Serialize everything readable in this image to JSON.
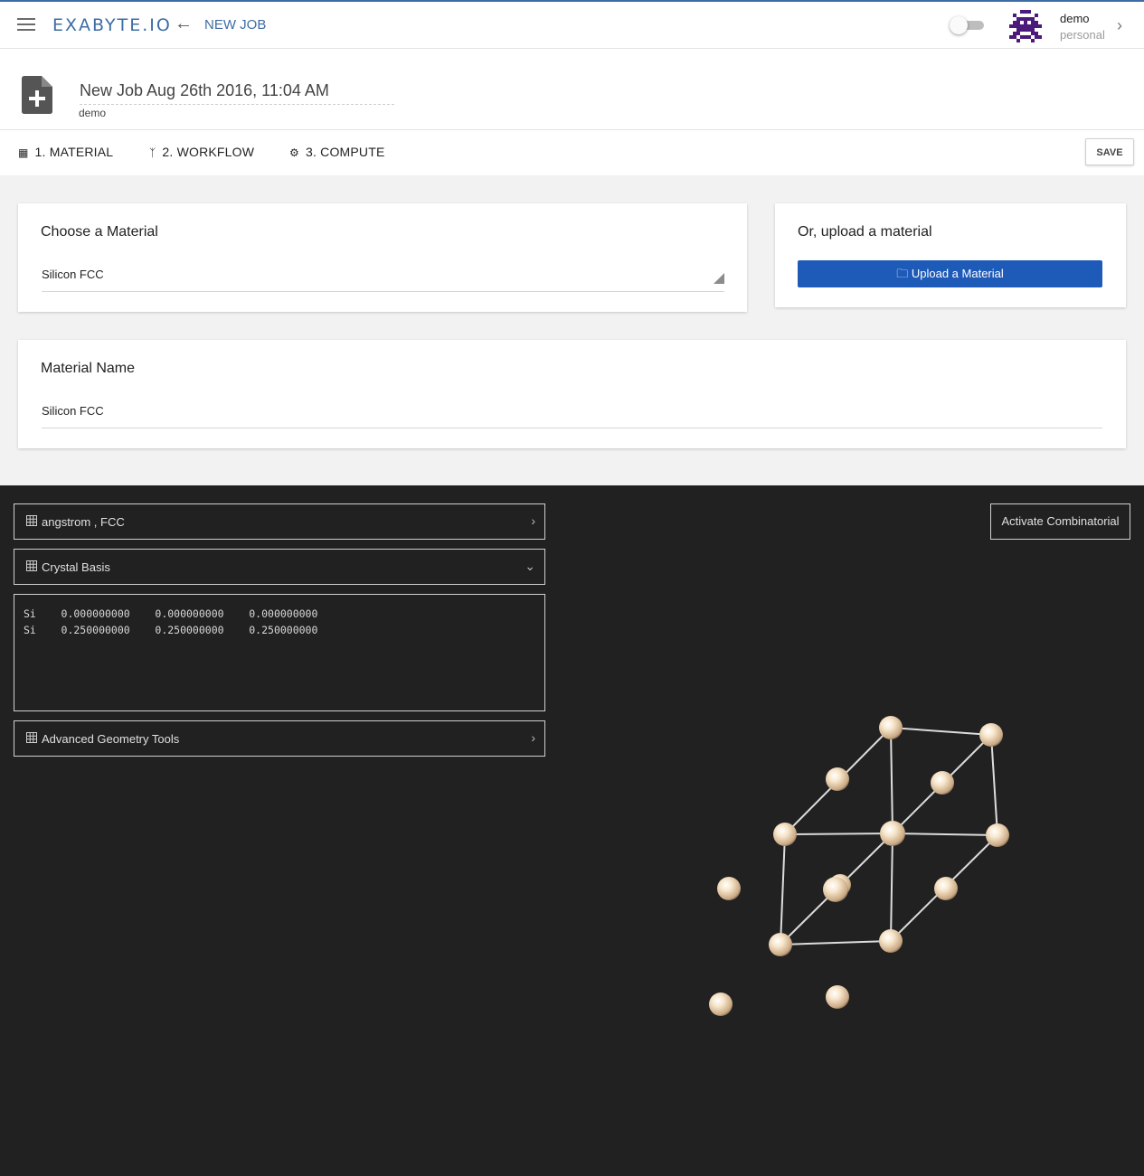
{
  "app": {
    "logo": "EXABYTE.IO",
    "breadcrumb": "NEW JOB",
    "user": {
      "name": "demo",
      "account": "personal"
    },
    "brand_color": "#3d6da4"
  },
  "job": {
    "title": "New Job Aug 26th 2016, 11:04 AM",
    "owner": "demo"
  },
  "tabs": [
    {
      "label": "1. MATERIAL",
      "icon": "grid-icon"
    },
    {
      "label": "2. WORKFLOW",
      "icon": "workflow-fork-icon"
    },
    {
      "label": "3. COMPUTE",
      "icon": "gear-icon"
    }
  ],
  "toolbar": {
    "save_label": "SAVE"
  },
  "choose_material": {
    "title": "Choose a Material",
    "selected": "Silicon FCC"
  },
  "upload_material": {
    "title": "Or, upload a material",
    "button_label": "Upload a Material",
    "button_color": "#1e5ab8"
  },
  "material_name": {
    "title": "Material Name",
    "value": "Silicon FCC"
  },
  "viewer": {
    "lattice_panel": "angstrom , FCC",
    "basis_panel": "Crystal Basis",
    "basis_text": "Si    0.000000000    0.000000000    0.000000000\nSi    0.250000000    0.250000000    0.250000000",
    "advanced_panel": "Advanced Geometry Tools",
    "combinatorial_button": "Activate Combinatorial",
    "background_color": "#212121",
    "atom_color": "#f5e3c8"
  }
}
